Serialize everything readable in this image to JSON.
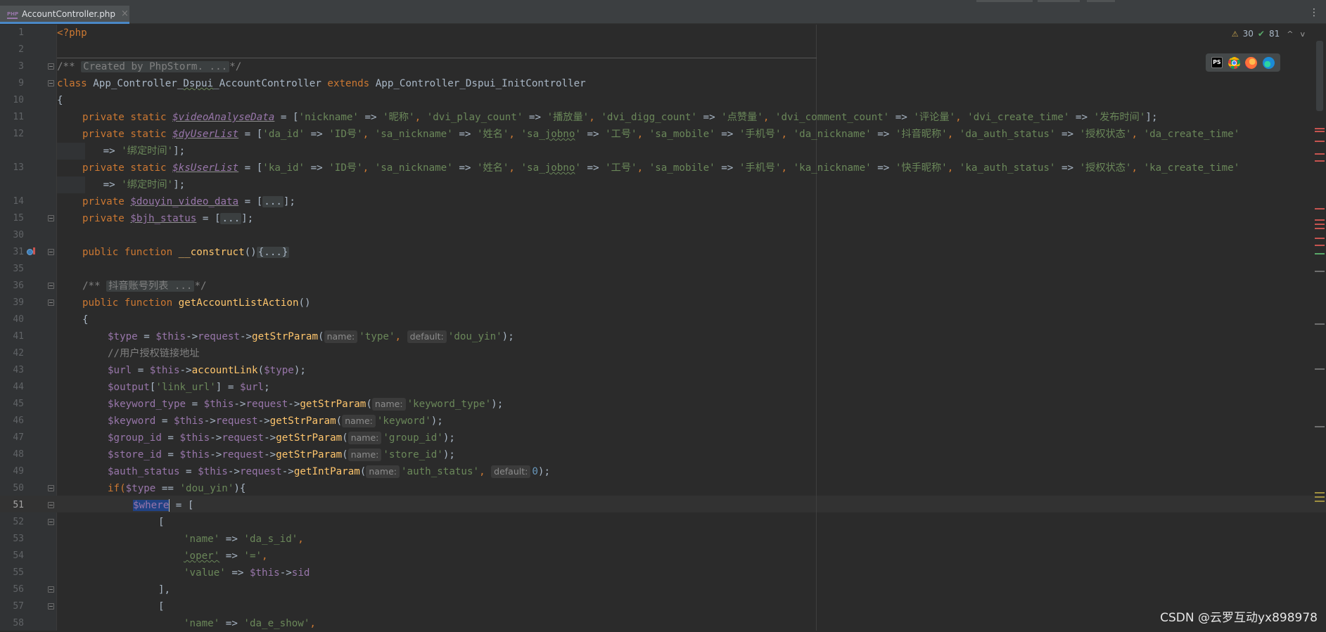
{
  "tab": {
    "file_name": "AccountController.php",
    "close": "×",
    "icon_label": "PHP",
    "menu": "⋮"
  },
  "inspections": {
    "warning_icon": "⚠",
    "warnings": "30",
    "ok_icon": "✔",
    "weak_warnings": "81",
    "up": "^",
    "down": "v"
  },
  "browsers": [
    "PhpStorm",
    "Chrome",
    "Firefox",
    "Edge"
  ],
  "watermark": "CSDN @云罗互动yx898978",
  "line_numbers": [
    "1",
    "2",
    "3",
    "9",
    "10",
    "11",
    "12",
    "",
    "13",
    "",
    "14",
    "15",
    "30",
    "31",
    "35",
    "36",
    "39",
    "40",
    "41",
    "42",
    "43",
    "44",
    "45",
    "46",
    "47",
    "48",
    "49",
    "50",
    "51",
    "52",
    "53",
    "54",
    "55",
    "56",
    "57",
    "58"
  ],
  "current_line": "51",
  "code": {
    "l1": "<?php",
    "l3_open": "/**",
    "l3_fold": "Created by PhpStorm. ...",
    "l3_close": "*/",
    "l9": [
      "class",
      "App_Controller_",
      "Dspui",
      "_AccountController",
      "extends",
      "App_Controller_Dspui_InitController"
    ],
    "l10": "{",
    "l11": [
      "private static",
      "$videoAnalyseData",
      "= [",
      "'nickname'",
      "=>",
      "'昵称'",
      "'dvi_play_count'",
      "'播放量'",
      "'dvi_digg_count'",
      "'点赞量'",
      "'dvi_comment_count'",
      "'评论量'",
      "'dvi_create_time'",
      "'发布时间'",
      "];"
    ],
    "l12": [
      "private static",
      "$dyUserList",
      "= [",
      "'da_id'",
      "=>",
      "'ID号'",
      "'sa_nickname'",
      "'姓名'",
      "'sa_",
      "jobno",
      "'",
      "'工号'",
      "'sa_mobile'",
      "'手机号'",
      "'da_nickname'",
      "'抖音昵称'",
      "'da_auth_status'",
      "'授权状态'",
      "'da_create_time'"
    ],
    "l12b": [
      "=>",
      "'绑定时间'",
      "];"
    ],
    "l13": [
      "private static",
      "$ksUserList",
      "= [",
      "'ka_id'",
      "=>",
      "'ID号'",
      "'sa_nickname'",
      "'姓名'",
      "'sa_",
      "jobno",
      "'",
      "'工号'",
      "'sa_mobile'",
      "'手机号'",
      "'ka_nickname'",
      "'快手昵称'",
      "'ka_auth_status'",
      "'授权状态'",
      "'ka_create_time'"
    ],
    "l13b": [
      "=>",
      "'绑定时间'",
      "];"
    ],
    "l14": [
      "private",
      "$douyin_video_data",
      "= [",
      "...",
      "];"
    ],
    "l15": [
      "private",
      "$bjh_status",
      "= [",
      "...",
      "];"
    ],
    "l31": [
      "public function",
      "__construct",
      "()",
      "{...}"
    ],
    "l36": [
      "/**",
      "抖音账号列表 ...",
      "*/"
    ],
    "l39": [
      "public function",
      "getAccountListAction",
      "()"
    ],
    "l40": "{",
    "l41": [
      "$type",
      " = ",
      "$this",
      "->",
      "request",
      "->",
      "getStrParam",
      "(",
      "name:",
      "'type'",
      ", ",
      "default:",
      "'dou_yin'",
      ");"
    ],
    "l42": "//用户授权链接地址",
    "l43": [
      "$url",
      " = ",
      "$this",
      "->",
      "accountLink",
      "(",
      "$type",
      ");"
    ],
    "l44": [
      "$output",
      "[",
      "'link_url'",
      "] = ",
      "$url",
      ";"
    ],
    "l45": [
      "$keyword_type",
      " = ",
      "$this",
      "->",
      "request",
      "->",
      "getStrParam",
      "(",
      "name:",
      "'keyword_type'",
      ");"
    ],
    "l46": [
      "$keyword",
      " = ",
      "$this",
      "->",
      "request",
      "->",
      "getStrParam",
      "(",
      "name:",
      "'keyword'",
      ");"
    ],
    "l47": [
      "$group_id",
      " = ",
      "$this",
      "->",
      "request",
      "->",
      "getStrParam",
      "(",
      "name:",
      "'group_id'",
      ");"
    ],
    "l48": [
      "$store_id",
      " = ",
      "$this",
      "->",
      "request",
      "->",
      "getStrParam",
      "(",
      "name:",
      "'store_id'",
      ");"
    ],
    "l49": [
      "$auth_status",
      " = ",
      "$this",
      "->",
      "request",
      "->",
      "getIntParam",
      "(",
      "name:",
      "'auth_status'",
      ", ",
      "default:",
      "0",
      ");"
    ],
    "l50": [
      "if(",
      "$type",
      " == ",
      "'dou_yin'",
      "){"
    ],
    "l51": [
      "$where",
      " = ["
    ],
    "l52": "[",
    "l53": [
      "'name'",
      " => ",
      "'da_s_id'",
      ","
    ],
    "l54": [
      "'oper'",
      " => ",
      "'='",
      ","
    ],
    "l55": [
      "'value'",
      " => ",
      "$this",
      "->",
      "sid"
    ],
    "l56": "],",
    "l57": "[",
    "l58": [
      "'name'",
      " => ",
      "'da_e_show'",
      ","
    ]
  },
  "colors": {
    "background": "#2b2b2b",
    "gutter": "#313335",
    "keyword": "#cc7832",
    "string": "#6a8759",
    "variable": "#9876aa",
    "function": "#ffc66d",
    "comment": "#808080",
    "text": "#a9b7c6"
  }
}
